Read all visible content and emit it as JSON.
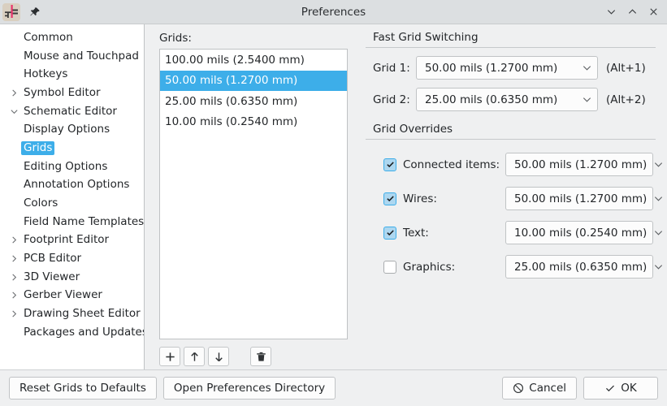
{
  "window": {
    "title": "Preferences",
    "app_icon": "kicad-schematic-icon",
    "pin_icon": "pin-icon",
    "controls": {
      "minimize": "chevron-down-icon",
      "maximize": "chevron-up-icon",
      "close": "close-icon"
    }
  },
  "sidebar": {
    "items": [
      {
        "label": "Common",
        "level": 1,
        "twisty": "none",
        "selected": false
      },
      {
        "label": "Mouse and Touchpad",
        "level": 1,
        "twisty": "none",
        "selected": false
      },
      {
        "label": "Hotkeys",
        "level": 1,
        "twisty": "none",
        "selected": false
      },
      {
        "label": "Symbol Editor",
        "level": 1,
        "twisty": "collapsed",
        "selected": false
      },
      {
        "label": "Schematic Editor",
        "level": 1,
        "twisty": "expanded",
        "selected": false
      },
      {
        "label": "Display Options",
        "level": 2,
        "twisty": "none",
        "selected": false
      },
      {
        "label": "Grids",
        "level": 2,
        "twisty": "none",
        "selected": true
      },
      {
        "label": "Editing Options",
        "level": 2,
        "twisty": "none",
        "selected": false
      },
      {
        "label": "Annotation Options",
        "level": 2,
        "twisty": "none",
        "selected": false
      },
      {
        "label": "Colors",
        "level": 2,
        "twisty": "none",
        "selected": false
      },
      {
        "label": "Field Name Templates",
        "level": 2,
        "twisty": "none",
        "selected": false
      },
      {
        "label": "Footprint Editor",
        "level": 1,
        "twisty": "collapsed",
        "selected": false
      },
      {
        "label": "PCB Editor",
        "level": 1,
        "twisty": "collapsed",
        "selected": false
      },
      {
        "label": "3D Viewer",
        "level": 1,
        "twisty": "collapsed",
        "selected": false
      },
      {
        "label": "Gerber Viewer",
        "level": 1,
        "twisty": "collapsed",
        "selected": false
      },
      {
        "label": "Drawing Sheet Editor",
        "level": 1,
        "twisty": "collapsed",
        "selected": false
      },
      {
        "label": "Packages and Updates",
        "level": 1,
        "twisty": "none",
        "selected": false
      }
    ]
  },
  "grids_panel": {
    "label": "Grids:",
    "items": [
      {
        "text": "100.00 mils (2.5400 mm)",
        "selected": false
      },
      {
        "text": "50.00 mils (1.2700 mm)",
        "selected": true
      },
      {
        "text": "25.00 mils (0.6350 mm)",
        "selected": false
      },
      {
        "text": "10.00 mils (0.2540 mm)",
        "selected": false
      }
    ],
    "toolbar": {
      "add": "plus-icon",
      "move_up": "arrow-up-icon",
      "move_down": "arrow-down-icon",
      "delete": "trash-icon"
    }
  },
  "fast_grid_switching": {
    "title": "Fast Grid Switching",
    "rows": [
      {
        "label": "Grid 1:",
        "value": "50.00 mils (1.2700 mm)",
        "hint": "(Alt+1)"
      },
      {
        "label": "Grid 2:",
        "value": "25.00 mils (0.6350 mm)",
        "hint": "(Alt+2)"
      }
    ]
  },
  "grid_overrides": {
    "title": "Grid Overrides",
    "rows": [
      {
        "label": "Connected items:",
        "checked": true,
        "value": "50.00 mils (1.2700 mm)"
      },
      {
        "label": "Wires:",
        "checked": true,
        "value": "50.00 mils (1.2700 mm)"
      },
      {
        "label": "Text:",
        "checked": true,
        "value": "10.00 mils (0.2540 mm)"
      },
      {
        "label": "Graphics:",
        "checked": false,
        "value": "25.00 mils (0.6350 mm)"
      }
    ]
  },
  "footer": {
    "reset": "Reset Grids to Defaults",
    "open_dir": "Open Preferences Directory",
    "cancel": "Cancel",
    "ok": "OK",
    "cancel_icon": "cancel-circle-icon",
    "ok_icon": "check-icon"
  },
  "colors": {
    "selection_blue": "#3daee9",
    "checkbox_fill": "#add7f0",
    "window_bg": "#eff0f1",
    "titlebar_bg": "#dcdfe1",
    "panel_white": "#ffffff"
  }
}
